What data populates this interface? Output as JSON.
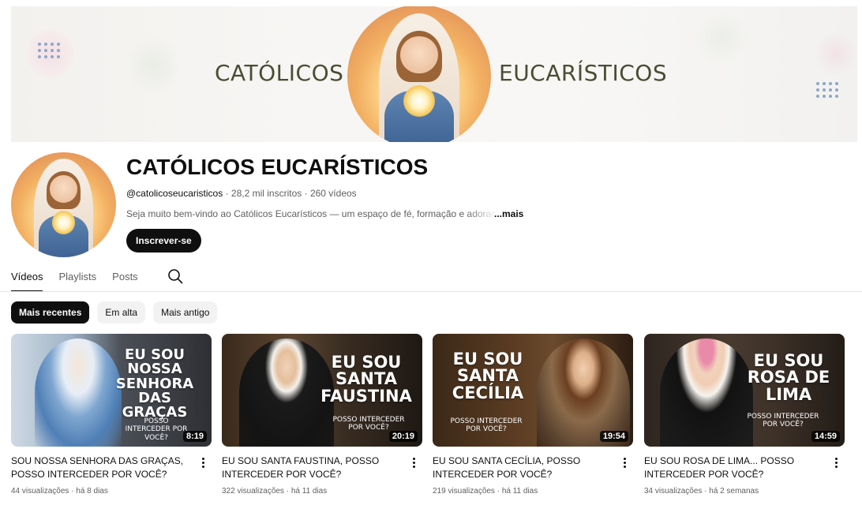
{
  "banner": {
    "left_text": "CATÓLICOS",
    "right_text": "EUCARÍSTICOS"
  },
  "channel": {
    "name": "CATÓLICOS EUCARÍSTICOS",
    "handle": "@catolicoseucaristicos",
    "subscribers": "28,2 mil inscritos",
    "videos_count": "260 vídeos",
    "separator": " · ",
    "description": "Seja muito bem-vindo ao Católicos Eucarísticos — um espaço de fé, formação e adoração",
    "more_label": "...mais",
    "subscribe_label": "Inscrever-se"
  },
  "tabs": [
    {
      "label": "Vídeos",
      "active": true
    },
    {
      "label": "Playlists",
      "active": false
    },
    {
      "label": "Posts",
      "active": false
    }
  ],
  "search_icon": "search-icon",
  "chips": [
    {
      "label": "Mais recentes",
      "active": true
    },
    {
      "label": "Em alta",
      "active": false
    },
    {
      "label": "Mais antigo",
      "active": false
    }
  ],
  "videos": [
    {
      "thumb_lines": [
        "EU SOU",
        "NOSSA",
        "SENHORA",
        "DAS GRAÇAS"
      ],
      "thumb_sub": "POSSO INTERCEDER POR VOCÊ?",
      "duration": "8:19",
      "title": "SOU NOSSA SENHORA DAS GRAÇAS, POSSO INTERCEDER POR VOCÊ?",
      "views": "44 visualizações",
      "age": "há 8 dias"
    },
    {
      "thumb_lines": [
        "EU SOU",
        "SANTA",
        "FAUSTINA"
      ],
      "thumb_sub": "POSSO INTERCEDER POR VOCÊ?",
      "duration": "20:19",
      "title": "EU SOU SANTA FAUSTINA, POSSO INTERCEDER POR VOCÊ?",
      "views": "322 visualizações",
      "age": "há 11 dias"
    },
    {
      "thumb_lines": [
        "EU SOU",
        "SANTA",
        "CECÍLIA"
      ],
      "thumb_sub": "POSSO INTERCEDER POR VOCÊ?",
      "duration": "19:54",
      "title": "EU SOU SANTA CECÍLIA, POSSO INTERCEDER POR VOCÊ?",
      "views": "219 visualizações",
      "age": "há 11 dias"
    },
    {
      "thumb_lines": [
        "EU SOU",
        "ROSA DE",
        "LIMA"
      ],
      "thumb_sub": "POSSO INTERCEDER POR VOCÊ?",
      "duration": "14:59",
      "title": "EU SOU ROSA DE LIMA... POSSO INTERCEDER POR VOCÊ?",
      "views": "34 visualizações",
      "age": "há 2 semanas"
    }
  ],
  "meta_separator": " · ",
  "colors": {
    "text_primary": "#0f0f0f",
    "text_secondary": "#606060",
    "chip_bg": "#f2f2f2",
    "banner_text": "#4a4d33"
  }
}
